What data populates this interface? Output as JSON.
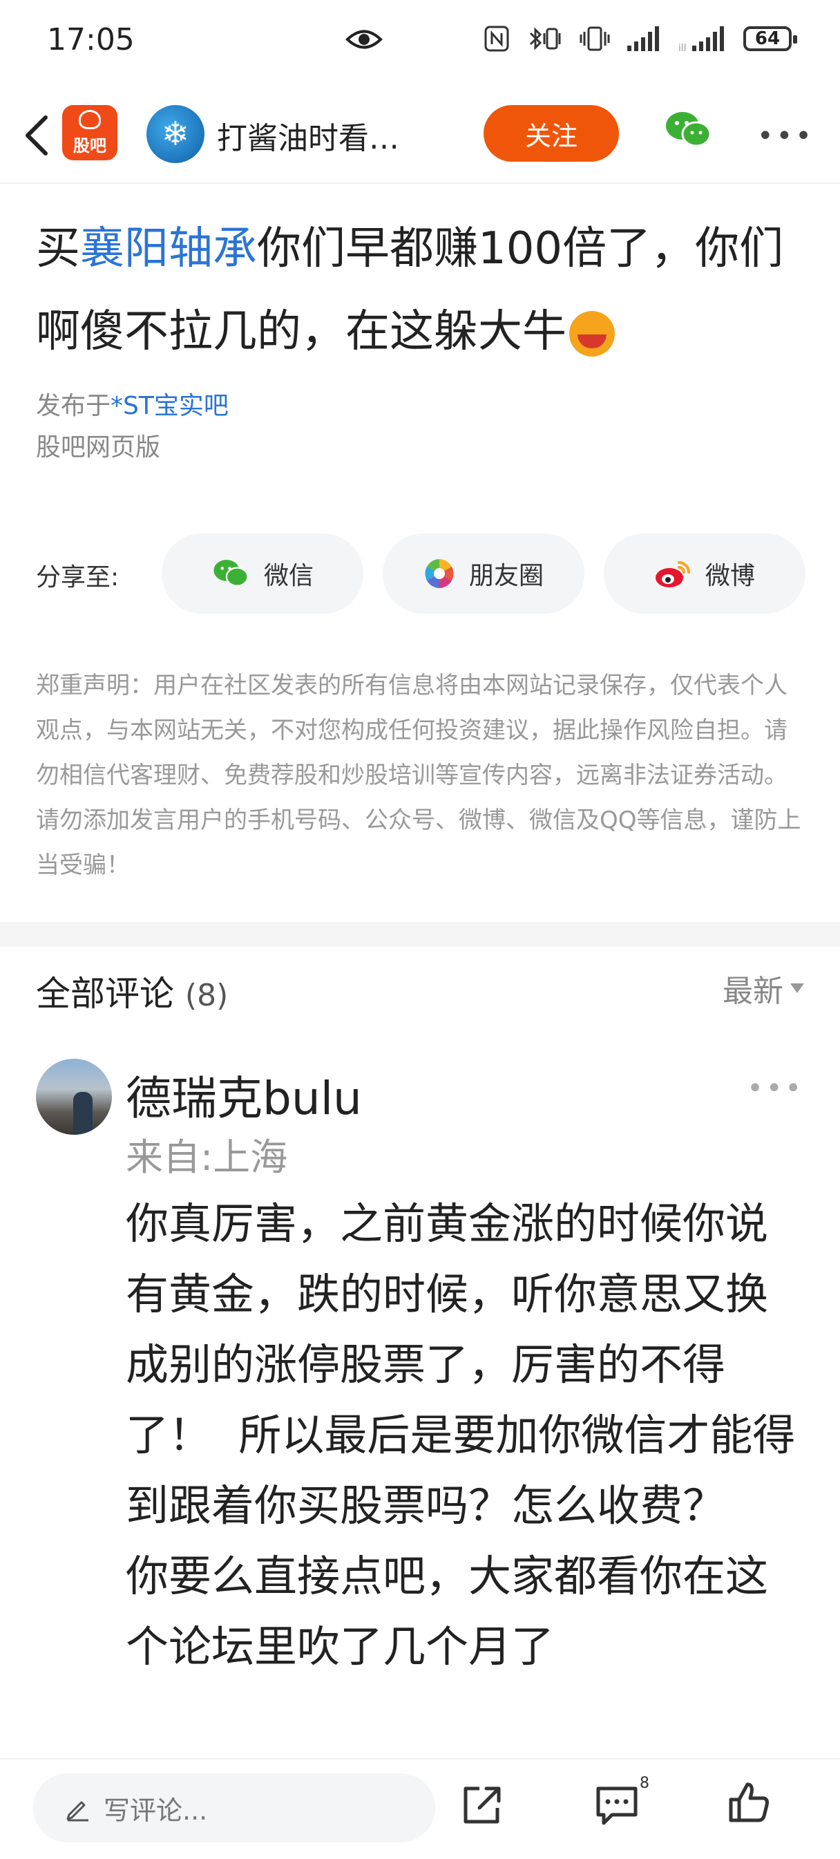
{
  "status": {
    "time": "17:05",
    "battery": "64"
  },
  "nav": {
    "app_logo_text": "股吧",
    "bar_name": "打酱油时看…",
    "follow_label": "关注"
  },
  "post": {
    "title_prefix": "买",
    "title_highlight": "襄阳轴承",
    "title_rest": "你们早都赚100倍了，你们啊傻不拉几的，在这躲大牛",
    "published_prefix": "发布于",
    "bar_link": "*ST宝实吧",
    "source": "股吧网页版"
  },
  "share": {
    "label": "分享至:",
    "buttons": [
      {
        "label": "微信",
        "icon": "wechat-icon"
      },
      {
        "label": "朋友圈",
        "icon": "moments-icon"
      },
      {
        "label": "微博",
        "icon": "weibo-icon"
      }
    ]
  },
  "disclaimer": "郑重声明：用户在社区发表的所有信息将由本网站记录保存，仅代表个人观点，与本网站无关，不对您构成任何投资建议，据此操作风险自担。请勿相信代客理财、免费荐股和炒股培训等宣传内容，远离非法证券活动。请勿添加发言用户的手机号码、公众号、微博、微信及QQ等信息，谨防上当受骗！",
  "comments": {
    "title": "全部评论",
    "count": "(8)",
    "sort_label": "最新",
    "items": [
      {
        "author": "德瑞克bulu",
        "location": "来自:上海",
        "text": "你真厉害，之前黄金涨的时候你说有黄金，跌的时候，听你意思又换成别的涨停股票了，厉害的不得了！  所以最后是要加你微信才能得到跟着你买股票吗？怎么收费？   你要么直接点吧，大家都看你在这个论坛里吹了几个月了"
      }
    ]
  },
  "bottom": {
    "comment_placeholder": "写评论...",
    "comment_badge": "8"
  },
  "colors": {
    "accent": "#f0560a",
    "link": "#2b74d6",
    "wechat": "#3cb034",
    "weibo": "#e6162d"
  }
}
